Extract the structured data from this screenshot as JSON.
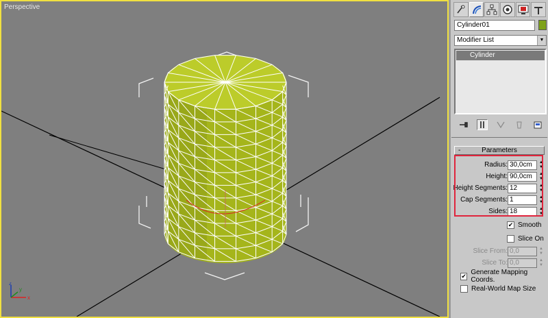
{
  "viewport": {
    "label": "Perspective",
    "axis": {
      "x": "x",
      "y": "y",
      "z": "z"
    }
  },
  "panel": {
    "tabs": [
      {
        "icon": "create-icon"
      },
      {
        "icon": "modify-icon"
      },
      {
        "icon": "hierarchy-icon"
      },
      {
        "icon": "motion-icon"
      },
      {
        "icon": "display-icon"
      },
      {
        "icon": "utilities-icon"
      }
    ],
    "object_name": "Cylinder01",
    "object_color": "#7ea21a",
    "modifier_list": "Modifier List",
    "stack_items": [
      "Cylinder"
    ],
    "rollout_title": "Parameters",
    "rollout_toggle": "-",
    "params": [
      {
        "label": "Radius:",
        "value": "30,0cm"
      },
      {
        "label": "Height:",
        "value": "90,0cm"
      },
      {
        "label": "Height Segments:",
        "value": "12"
      },
      {
        "label": "Cap Segments:",
        "value": "1"
      },
      {
        "label": "Sides:",
        "value": "18"
      }
    ],
    "smooth": {
      "label": "Smooth",
      "checked": true
    },
    "slice_on": {
      "label": "Slice On",
      "checked": false
    },
    "slice_from": {
      "label": "Slice From:",
      "value": "0,0"
    },
    "slice_to": {
      "label": "Slice To:",
      "value": "0,0"
    },
    "gen_mapping": {
      "label": "Generate Mapping Coords.",
      "checked": true
    },
    "real_world": {
      "label": "Real-World Map Size",
      "checked": false
    },
    "highlight_color": "#e0243c"
  }
}
